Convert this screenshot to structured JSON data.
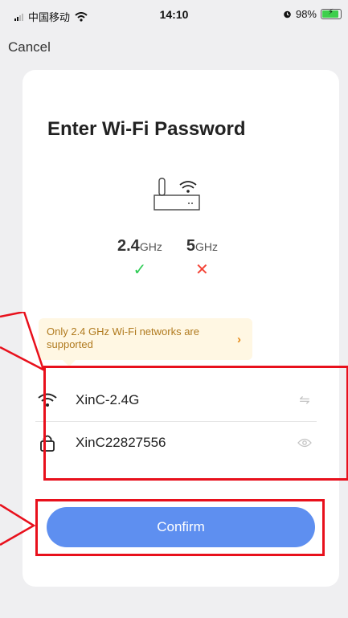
{
  "status_bar": {
    "carrier": "中国移动",
    "time": "14:10",
    "battery": "98%"
  },
  "nav": {
    "cancel_label": "Cancel"
  },
  "card": {
    "title": "Enter Wi-Fi Password",
    "bands": [
      {
        "value": "2.4",
        "unit": "GHz",
        "supported": true
      },
      {
        "value": "5",
        "unit": "GHz",
        "supported": false
      }
    ],
    "tip": "Only 2.4 GHz Wi-Fi networks are supported",
    "ssid_value": "XinC-2.4G",
    "password_value": "XinC22827556",
    "confirm_label": "Confirm"
  },
  "colors": {
    "accent": "#5e8ff0",
    "supported": "#2ecc55",
    "unsupported": "#f44336",
    "annotation": "#e8101c",
    "tip_text": "#b07a1e"
  },
  "icons": {
    "router": "router-icon",
    "wifi": "wifi-icon",
    "lock": "lock-icon",
    "switch": "switch-network-icon",
    "eye": "eye-icon",
    "check": "check-icon",
    "cross": "cross-icon"
  }
}
